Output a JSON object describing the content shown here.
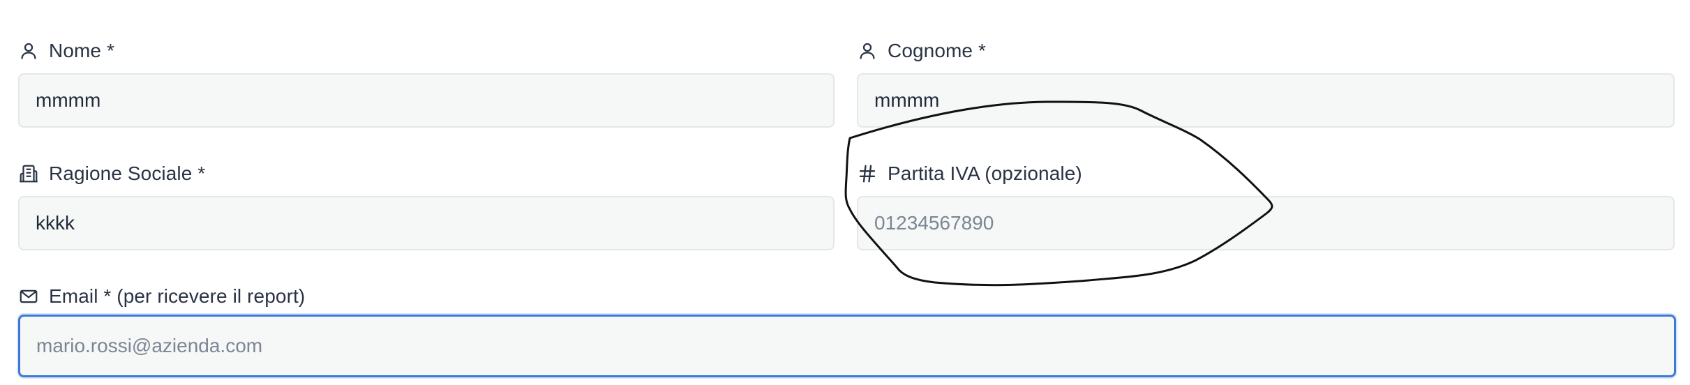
{
  "form": {
    "fields": [
      {
        "key": "nome",
        "label": "Nome *",
        "icon": "user-icon",
        "value": "mmmm",
        "placeholder": ""
      },
      {
        "key": "cognome",
        "label": "Cognome *",
        "icon": "user-icon",
        "value": "mmmm",
        "placeholder": ""
      },
      {
        "key": "ragione_sociale",
        "label": "Ragione Sociale *",
        "icon": "building-icon",
        "value": "kkkk",
        "placeholder": ""
      },
      {
        "key": "partita_iva",
        "label": "Partita IVA (opzionale)",
        "icon": "hash-icon",
        "value": "",
        "placeholder": "01234567890"
      },
      {
        "key": "email",
        "label": "Email * (per ricevere il report)",
        "icon": "mail-icon",
        "value": "",
        "placeholder": "mario.rossi@azienda.com",
        "focused": true
      }
    ]
  },
  "colors": {
    "text": "#2a3344",
    "input_background": "#f6f7f7",
    "input_border": "#e4e7ea",
    "focus_border": "#3f79d8",
    "placeholder": "#7c8694",
    "annotation_stroke": "#111111"
  }
}
